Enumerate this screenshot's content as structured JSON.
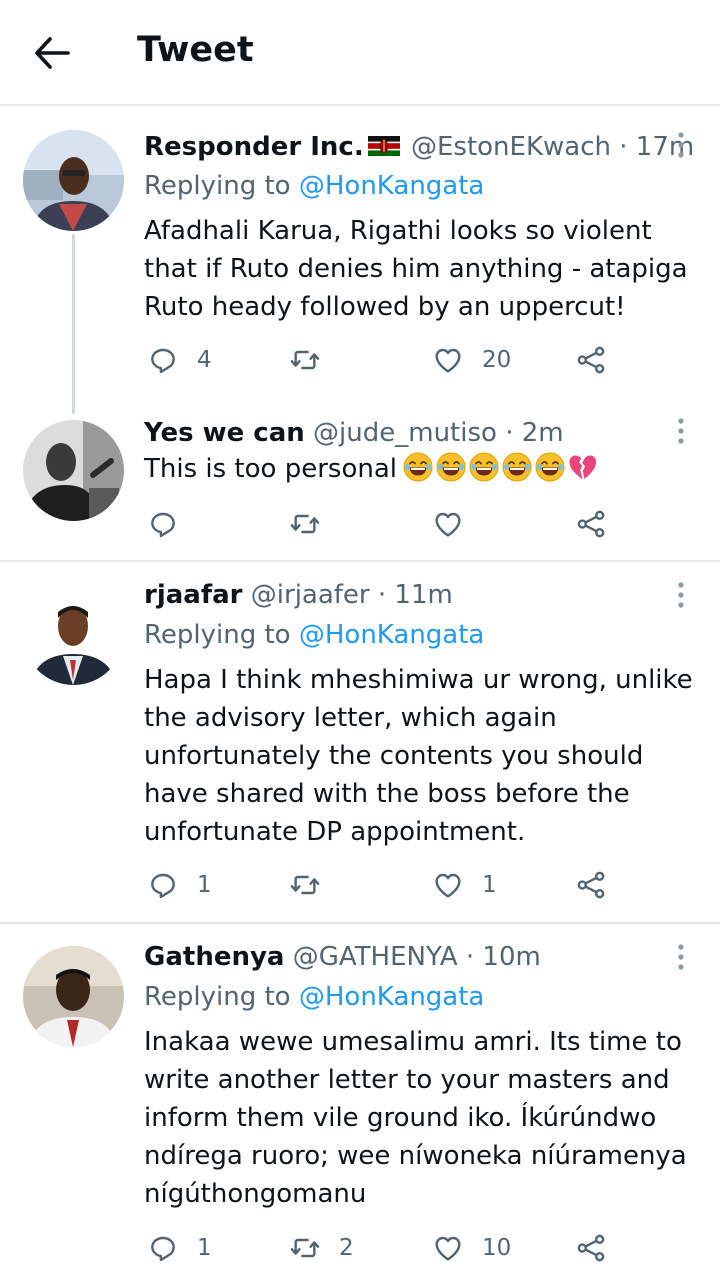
{
  "header": {
    "title": "Tweet"
  },
  "tweets": [
    {
      "name": "Responder Inc.",
      "handle": "@EstonEKwach",
      "time": "17m",
      "replying_label": "Replying to",
      "replying_to": "@HonKangata",
      "text": "Afadhali Karua, Rigathi looks so violent that if Ruto denies him anything - atapiga Ruto heady followed by an uppercut!",
      "replies": "4",
      "retweets": "",
      "likes": "20"
    },
    {
      "name": "Yes we can",
      "handle": "@jude_mutiso",
      "time": "2m",
      "text": "This is too personal",
      "emojis": [
        "joy-emoji",
        "joy-emoji",
        "joy-emoji",
        "joy-emoji",
        "joy-emoji",
        "broken-heart-emoji"
      ],
      "replies": "",
      "retweets": "",
      "likes": ""
    },
    {
      "name": "rjaafar",
      "handle": "@irjaafer",
      "time": "11m",
      "replying_label": "Replying to",
      "replying_to": "@HonKangata",
      "text": "Hapa I think mheshimiwa ur wrong, unlike the advisory letter,  which again unfortunately the contents you should have shared with the boss before the unfortunate DP appointment.",
      "replies": "1",
      "retweets": "",
      "likes": "1"
    },
    {
      "name": "Gathenya",
      "handle": "@GATHENYA",
      "time": "10m",
      "replying_label": "Replying to",
      "replying_to": "@HonKangata",
      "text": "Inakaa wewe umesalimu amri. Its time to write another letter to your masters and inform them vile ground iko. Íkúrúndwo ndírega ruoro; wee níwoneka níúramenya nígúthongomanu",
      "replies": "1",
      "retweets": "2",
      "likes": "10"
    }
  ],
  "colors": {
    "link": "#1d9bf0",
    "muted": "#536471",
    "text": "#0f1419",
    "divider": "#e5e8eb"
  },
  "icons": [
    "back-arrow-icon",
    "more-icon",
    "reply-icon",
    "retweet-icon",
    "like-icon",
    "share-icon",
    "kenya-flag-icon"
  ]
}
